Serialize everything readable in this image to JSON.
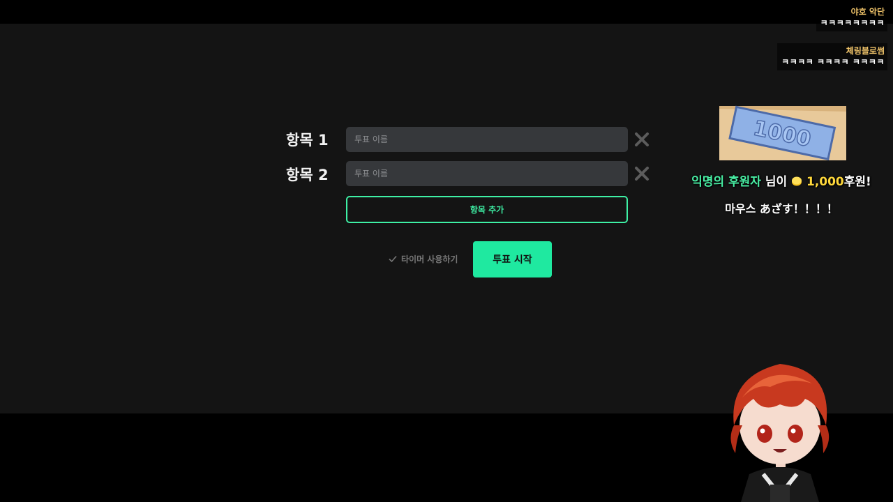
{
  "vote": {
    "items": [
      {
        "label": "항목 1",
        "placeholder": "투표 이름"
      },
      {
        "label": "항목 2",
        "placeholder": "투표 이름"
      }
    ],
    "add_item_label": "항목 추가",
    "timer_label": "타이머 사용하기",
    "start_label": "투표 시작"
  },
  "chat": [
    {
      "user": "야호 악단",
      "text": "ㅋㅋㅋㅋㅋㅋㅋㅋ"
    },
    {
      "user": "체링블로썸",
      "text": "ㅋㅋㅋㅋ ㅋㅋㅋㅋ ㅋㅋㅋㅋ"
    }
  ],
  "donation": {
    "image_text": "1000",
    "donor": "익명의 후원자",
    "suffix": "님이",
    "amount": "1,000",
    "action": "후원!",
    "message": "마우스 あざす！！！！"
  },
  "colors": {
    "accent": "#1fe9a0",
    "accent_outline": "#3ef0a5",
    "panel_bg": "#141414",
    "input_bg": "#36383b",
    "chat_user": "#f3c66b",
    "donation_amount": "#ffd83b"
  },
  "icons": {
    "remove": "close-icon",
    "timer": "checkmark-icon",
    "coin": "coin-icon"
  }
}
